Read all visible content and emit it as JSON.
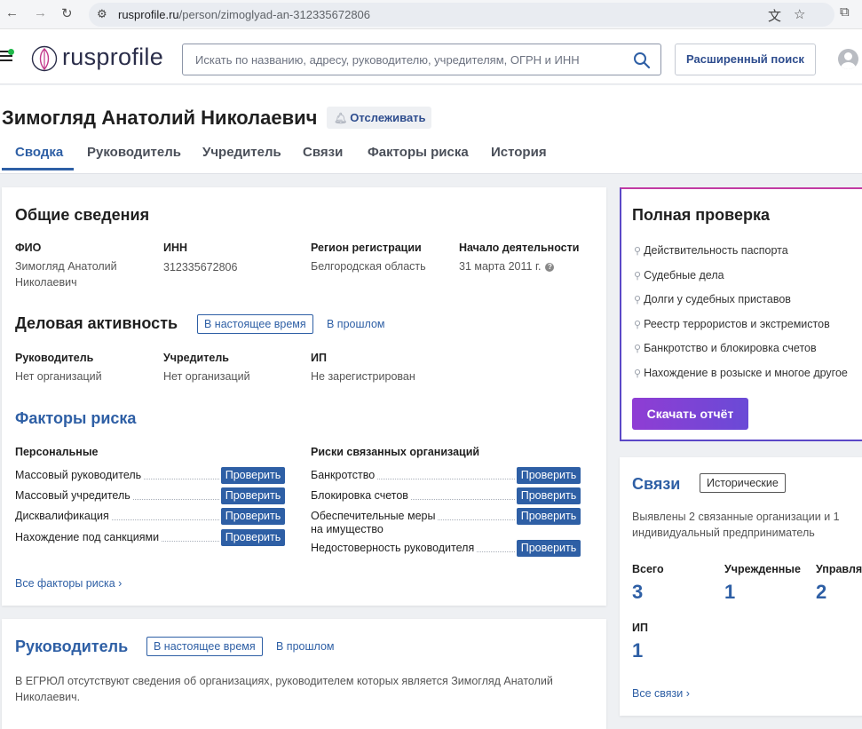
{
  "browser": {
    "url_host": "rusprofile.ru",
    "url_path": "/person/zimoglyad-an-312335672806"
  },
  "site": {
    "logo_text": "rusprofile",
    "search_placeholder": "Искать по названию, адресу, руководителю, учредителям, ОГРН и ИНН",
    "advanced_search": "Расширенный поиск"
  },
  "person": {
    "name": "Зимогляд Анатолий Николаевич",
    "follow": "Отслеживать"
  },
  "tabs": [
    "Сводка",
    "Руководитель",
    "Учредитель",
    "Связи",
    "Факторы риска",
    "История"
  ],
  "general": {
    "title": "Общие сведения",
    "fio_label": "ФИО",
    "fio_line1": "Зимогляд Анатолий",
    "fio_line2": "Николаевич",
    "inn_label": "ИНН",
    "inn_value": "312335672806",
    "region_label": "Регион регистрации",
    "region_value": "Белгородская область",
    "start_label": "Начало деятельности",
    "start_value": "31 марта 2011 г."
  },
  "business": {
    "title": "Деловая активность",
    "now_chip": "В настоящее время",
    "past_link": "В прошлом",
    "director_label": "Руководитель",
    "director_value": "Нет организаций",
    "founder_label": "Учредитель",
    "founder_value": "Нет организаций",
    "ip_label": "ИП",
    "ip_value": "Не зарегистрирован"
  },
  "risks": {
    "title": "Факторы риска",
    "personal_title": "Персональные",
    "orgs_title": "Риски связанных организаций",
    "check_label": "Проверить",
    "personal": [
      "Массовый руководитель",
      "Массовый учредитель",
      "Дисквалификация",
      "Нахождение под санкциями"
    ],
    "orgs": [
      "Банкротство",
      "Блокировка счетов",
      "Обеспечительные меры",
      "на имущество",
      "Недостоверность руководителя"
    ],
    "all_link": "Все факторы риска"
  },
  "director_card": {
    "title": "Руководитель",
    "now_chip": "В настоящее время",
    "past_link": "В прошлом",
    "text_line1": "В ЕГРЮЛ отсутствуют сведения об организациях, руководителем которых является Зимогляд Анатолий",
    "text_line2": "Николаевич."
  },
  "full_check": {
    "title": "Полная проверка",
    "items": [
      "Действительность паспорта",
      "Судебные дела",
      "Долги у судебных приставов",
      "Реестр террористов и экстремистов",
      "Банкротство и блокировка счетов",
      "Нахождение в розыске и многое другое"
    ],
    "button": "Скачать отчёт"
  },
  "links_card": {
    "title": "Связи",
    "historical_chip": "Исторические",
    "desc_line1": "Выявлены 2 связанные организации и 1",
    "desc_line2": "индивидуальный предприниматель",
    "total_label": "Всего",
    "total_value": "3",
    "founded_label": "Учрежденные",
    "founded_value": "1",
    "managed_label": "Управляемые",
    "managed_value": "2",
    "ip_label": "ИП",
    "ip_value": "1",
    "all_link": "Все связи"
  },
  "colors": {
    "brand_blue": "#2e5fa5",
    "cta_gradient_start": "#8f3dd4",
    "cta_gradient_end": "#6a4ad6"
  }
}
